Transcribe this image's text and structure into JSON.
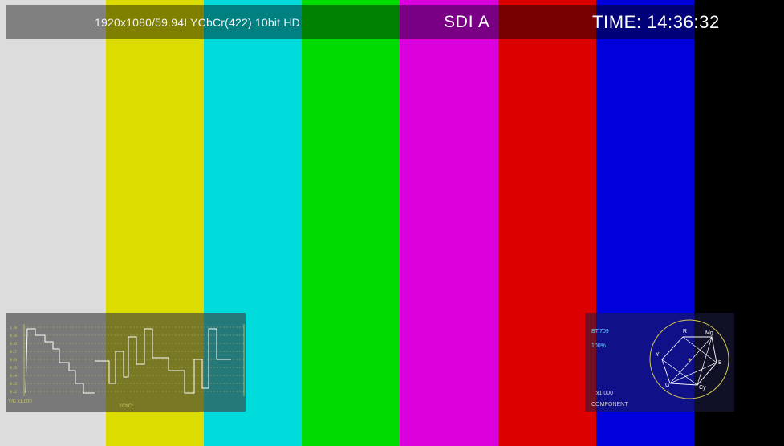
{
  "header": {
    "format_text": "1920x1080/59.94I YCbCr(422) 10bit HD",
    "input_label": "SDI A",
    "time_text": "TIME: 14:36:32"
  },
  "color_bars": [
    {
      "name": "white",
      "color": "#dcdcdc"
    },
    {
      "name": "yellow",
      "color": "#dcdc00"
    },
    {
      "name": "cyan",
      "color": "#00dcdc"
    },
    {
      "name": "green",
      "color": "#00dc00"
    },
    {
      "name": "magenta",
      "color": "#dc00dc"
    },
    {
      "name": "red",
      "color": "#dc0000"
    },
    {
      "name": "blue",
      "color": "#0000dc"
    },
    {
      "name": "black",
      "color": "#000000"
    }
  ],
  "waveform": {
    "mode_label": "Y/C x1.000",
    "sub_label": "YCbCr",
    "trace_color": "#ffffff",
    "graticule_color": "#c8c864"
  },
  "vectorscope": {
    "standard": "BT.709",
    "percent": "100%",
    "gain": "x1.000",
    "mode": "COMPONENT",
    "targets": [
      "R",
      "Mg",
      "B",
      "Cy",
      "G",
      "Yl"
    ],
    "circle_color": "#d4c84a",
    "text_color": "#5fd2ff"
  }
}
